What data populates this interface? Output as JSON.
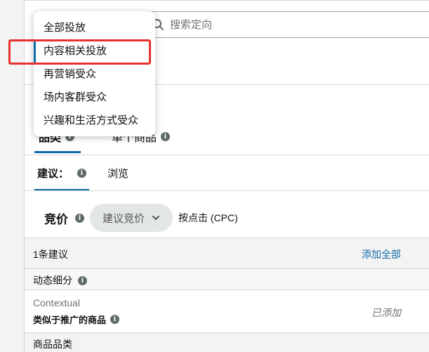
{
  "search": {
    "placeholder": "搜索定向"
  },
  "dropdown": {
    "items": [
      {
        "label": "全部投放"
      },
      {
        "label": "内容相关投放"
      },
      {
        "label": "再营销受众"
      },
      {
        "label": "场内客群受众"
      },
      {
        "label": "兴趣和生活方式受众"
      }
    ]
  },
  "tabs": {
    "category": "品类",
    "product": "单个商品"
  },
  "subtabs": {
    "suggested": "建议：",
    "browse": "浏览"
  },
  "bid": {
    "label": "竞价",
    "select_value": "建议竞价",
    "type": "按点击 (CPC)"
  },
  "suggestions": {
    "count_text": "1条建议",
    "add_all": "添加全部"
  },
  "dynamic_segments": {
    "title": "动态细分"
  },
  "contextual": {
    "type": "Contextual",
    "name": "类似于推广的商品",
    "status": "已添加"
  },
  "product_category": {
    "title": "商品品类"
  },
  "colors": {
    "accent": "#0f6aa8",
    "highlight": "#e5322d"
  }
}
